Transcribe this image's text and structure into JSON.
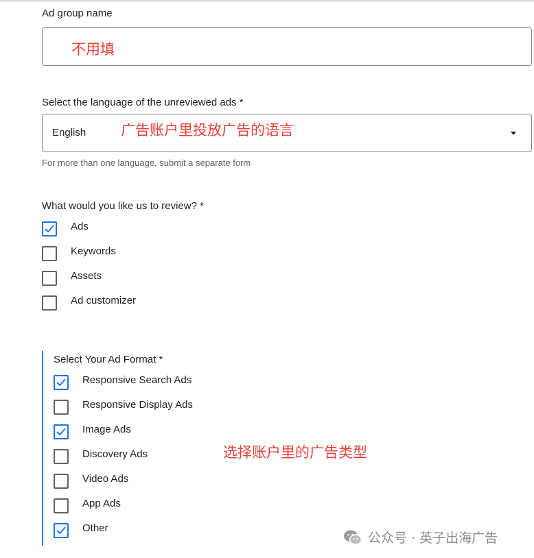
{
  "ad_group": {
    "label": "Ad group name",
    "annotation": "不用填"
  },
  "language": {
    "label": "Select the language of the unreviewed ads *",
    "selected": "English",
    "annotation": "广告账户里投放广告的语言",
    "helper": "For more than one language, submit a separate form"
  },
  "review": {
    "label": "What would you like us to review? *",
    "options": [
      {
        "label": "Ads",
        "checked": true
      },
      {
        "label": "Keywords",
        "checked": false
      },
      {
        "label": "Assets",
        "checked": false
      },
      {
        "label": "Ad customizer",
        "checked": false
      }
    ]
  },
  "ad_format": {
    "label": "Select Your Ad Format *",
    "annotation": "选择账户里的广告类型",
    "options": [
      {
        "label": "Responsive Search Ads",
        "checked": true
      },
      {
        "label": "Responsive Display Ads",
        "checked": false
      },
      {
        "label": "Image Ads",
        "checked": true
      },
      {
        "label": "Discovery Ads",
        "checked": false
      },
      {
        "label": "Video Ads",
        "checked": false
      },
      {
        "label": "App Ads",
        "checked": false
      },
      {
        "label": "Other",
        "checked": true
      }
    ]
  },
  "watermark": {
    "text": "公众号 · 英子出海广告"
  },
  "colors": {
    "accent": "#1a73e8",
    "annotation": "#e8413b",
    "border": "#80868b"
  }
}
